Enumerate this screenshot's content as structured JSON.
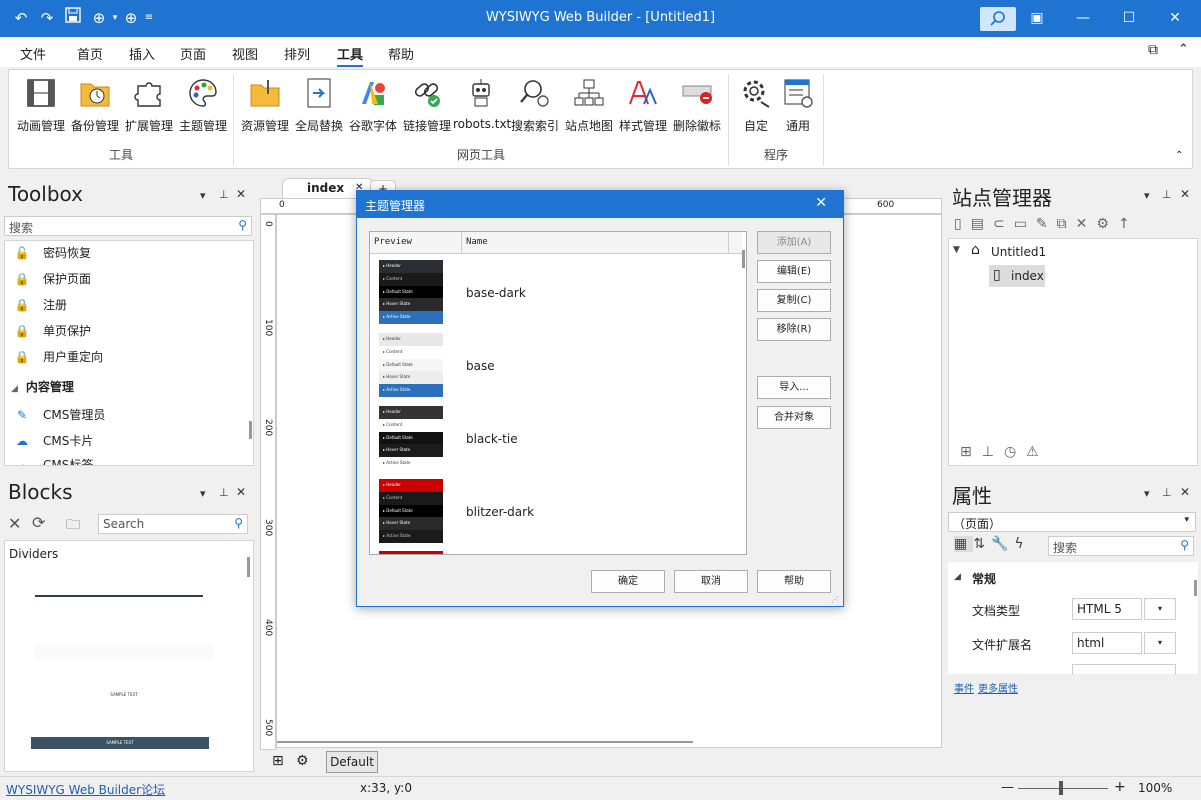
{
  "titlebar": {
    "title": "WYSIWYG Web Builder - [Untitled1]",
    "quick_icons": [
      "undo-icon",
      "redo-icon",
      "save-icon",
      "globe-preview-icon",
      "web-publish-icon"
    ]
  },
  "menu": {
    "items": [
      "文件",
      "首页",
      "插入",
      "页面",
      "视图",
      "排列",
      "工具",
      "帮助"
    ],
    "active": "工具"
  },
  "ribbon": {
    "tools_group": {
      "label": "工具",
      "buttons": [
        "动画管理",
        "备份管理",
        "扩展管理",
        "主题管理"
      ]
    },
    "web_tools_group": {
      "label": "网页工具",
      "buttons": [
        "资源管理",
        "全局替换",
        "谷歌字体",
        "链接管理",
        "robots.txt",
        "搜索索引",
        "站点地图",
        "样式管理",
        "删除徽标"
      ]
    },
    "program_group": {
      "label": "程序",
      "buttons": [
        "自定",
        "通用"
      ]
    }
  },
  "toolbox": {
    "title": "Toolbox",
    "search_placeholder": "搜索",
    "items": [
      "密码恢复",
      "保护页面",
      "注册",
      "单页保护",
      "用户重定向"
    ],
    "section": "内容管理",
    "cms_items": [
      "CMS管理员",
      "CMS卡片",
      "CMS标签"
    ]
  },
  "blocks": {
    "title": "Blocks",
    "search_placeholder": "Search",
    "category": "Dividers",
    "sample_text": "SAMPLE TEXT"
  },
  "editor": {
    "tab_label": "index",
    "ruler_h": [
      "0",
      "600"
    ],
    "ruler_v": [
      "0",
      "100",
      "200",
      "300",
      "400",
      "500"
    ],
    "bottom_tab": "Default"
  },
  "dialog": {
    "title": "主题管理器",
    "col_preview": "Preview",
    "col_name": "Name",
    "themes": [
      {
        "name": "base-dark",
        "rows": [
          "Header",
          "Content",
          "Default State",
          "Hover State",
          "Active State"
        ],
        "colors": [
          "#2b2d30",
          "#1a1a1a",
          "#000000",
          "#2a2a2a",
          "#2c6fbb"
        ],
        "fg": [
          "#fff",
          "#ccc",
          "#fff",
          "#fff",
          "#fff"
        ]
      },
      {
        "name": "base",
        "rows": [
          "Header",
          "Content",
          "Default State",
          "Hover State",
          "Active State"
        ],
        "colors": [
          "#e8e8e8",
          "#ffffff",
          "#f6f6f6",
          "#ededed",
          "#2c6fbb"
        ],
        "fg": [
          "#333",
          "#333",
          "#333",
          "#333",
          "#fff"
        ]
      },
      {
        "name": "black-tie",
        "rows": [
          "Header",
          "Content",
          "Default State",
          "Hover State",
          "Active State"
        ],
        "colors": [
          "#333333",
          "#ffffff",
          "#111111",
          "#1c1c1c",
          "#ffffff"
        ],
        "fg": [
          "#fff",
          "#333",
          "#fff",
          "#fff",
          "#333"
        ]
      },
      {
        "name": "blitzer-dark",
        "rows": [
          "Header",
          "Content",
          "Default State",
          "Hover State",
          "Active State"
        ],
        "colors": [
          "#cc0000",
          "#1a1a1a",
          "#000000",
          "#2a2a2a",
          "#1a1a1a"
        ],
        "fg": [
          "#fff",
          "#ccc",
          "#fff",
          "#fff",
          "#ccc"
        ]
      }
    ],
    "buttons": {
      "add": "添加(A)",
      "edit": "编辑(E)",
      "copy": "复制(C)",
      "remove": "移除(R)",
      "import": "导入...",
      "merge": "合并对象",
      "ok": "确定",
      "cancel": "取消",
      "help": "帮助"
    }
  },
  "site_manager": {
    "title": "站点管理器",
    "root": "Untitled1",
    "page": "index"
  },
  "properties": {
    "title": "属性",
    "selector_value": "（页面）",
    "search_placeholder": "搜索",
    "section": "常规",
    "rows": [
      {
        "label": "文档类型",
        "value": "HTML 5"
      },
      {
        "label": "文件扩展名",
        "value": "html"
      }
    ],
    "links": [
      "事件",
      "更多属性"
    ]
  },
  "status": {
    "forum_link": "WYSIWYG Web Builder论坛",
    "coords": "x:33, y:0",
    "zoom": "100%"
  },
  "colors": {
    "accent": "#1e74d0"
  }
}
